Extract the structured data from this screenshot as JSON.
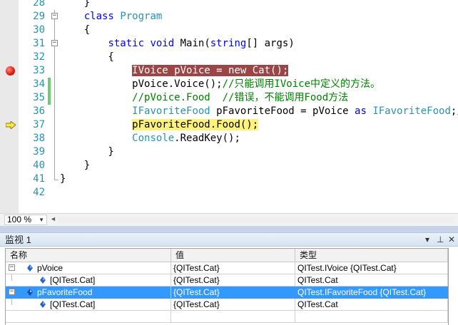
{
  "editor": {
    "lines": [
      {
        "num": "28",
        "segs": [
          {
            "t": "    }",
            "c": ""
          }
        ]
      },
      {
        "num": "29",
        "segs": [
          {
            "t": "    ",
            "c": ""
          },
          {
            "t": "class",
            "c": "k"
          },
          {
            "t": " ",
            "c": ""
          },
          {
            "t": "Program",
            "c": "t"
          }
        ]
      },
      {
        "num": "30",
        "segs": [
          {
            "t": "    {",
            "c": ""
          }
        ]
      },
      {
        "num": "31",
        "segs": [
          {
            "t": "        ",
            "c": ""
          },
          {
            "t": "static",
            "c": "k"
          },
          {
            "t": " ",
            "c": ""
          },
          {
            "t": "void",
            "c": "k"
          },
          {
            "t": " Main(",
            "c": ""
          },
          {
            "t": "string",
            "c": "k"
          },
          {
            "t": "[] args)",
            "c": ""
          }
        ]
      },
      {
        "num": "32",
        "segs": [
          {
            "t": "        {",
            "c": ""
          }
        ]
      },
      {
        "num": "33",
        "segs": [
          {
            "t": "            ",
            "c": ""
          },
          {
            "t": "IVoice pVoice = new Cat();",
            "c": "hl-bp"
          }
        ]
      },
      {
        "num": "34",
        "segs": [
          {
            "t": "            pVoice.Voice();",
            "c": ""
          },
          {
            "t": "//只能调用IVoice中定义的方法。",
            "c": "c"
          }
        ]
      },
      {
        "num": "35",
        "segs": [
          {
            "t": "            ",
            "c": ""
          },
          {
            "t": "//pVoice.Food  //错误，不能调用Food方法",
            "c": "c"
          }
        ]
      },
      {
        "num": "36",
        "segs": [
          {
            "t": "            ",
            "c": ""
          },
          {
            "t": "IFavoriteFood",
            "c": "t"
          },
          {
            "t": " pFavoriteFood = pVoice ",
            "c": ""
          },
          {
            "t": "as",
            "c": "k"
          },
          {
            "t": " ",
            "c": ""
          },
          {
            "t": "IFavoriteFood",
            "c": "t"
          },
          {
            "t": ";",
            "c": ""
          },
          {
            "t": "//只",
            "c": "c"
          }
        ]
      },
      {
        "num": "37",
        "segs": [
          {
            "t": "            ",
            "c": ""
          },
          {
            "t": "pFavoriteFood.Food();",
            "c": "hl-ip"
          }
        ]
      },
      {
        "num": "38",
        "segs": [
          {
            "t": "            ",
            "c": ""
          },
          {
            "t": "Console",
            "c": "t"
          },
          {
            "t": ".ReadKey();",
            "c": ""
          }
        ]
      },
      {
        "num": "39",
        "segs": [
          {
            "t": "        }",
            "c": ""
          }
        ]
      },
      {
        "num": "40",
        "segs": [
          {
            "t": "    }",
            "c": ""
          }
        ]
      },
      {
        "num": "41",
        "segs": [
          {
            "t": "}",
            "c": ""
          }
        ]
      },
      {
        "num": "42",
        "segs": []
      }
    ]
  },
  "statusbar": {
    "zoom": "100 %"
  },
  "watch": {
    "title": "监视 1",
    "columns": [
      "名称",
      "值",
      "类型"
    ],
    "rows": [
      {
        "name": "pVoice",
        "value": "{QITest.Cat}",
        "type": "QITest.IVoice {QITest.Cat}"
      },
      {
        "name": "[QITest.Cat]",
        "value": "{QITest.Cat}",
        "type": "QITest.Cat"
      },
      {
        "name": "pFavoriteFood",
        "value": "{QITest.Cat}",
        "type": "QITest.IFavoriteFood {QITest.Cat}"
      },
      {
        "name": "[QITest.Cat]",
        "value": "{QITest.Cat}",
        "type": "QITest.Cat"
      }
    ]
  }
}
